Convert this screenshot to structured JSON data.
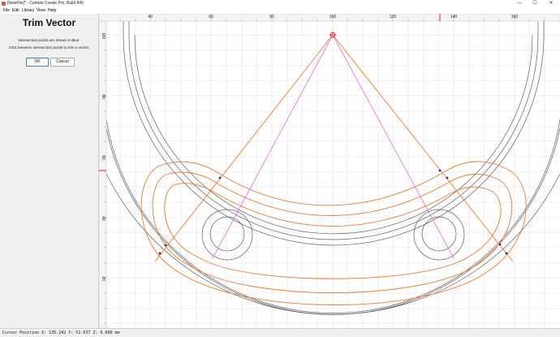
{
  "window": {
    "title": "[NewFile]* - Carbide Create Pro, Build 845",
    "minimize_glyph": "—",
    "maximize_glyph": "☐",
    "close_glyph": "✕",
    "app_icon": "carbide-create-icon"
  },
  "menu": [
    "File",
    "Edit",
    "Library",
    "View",
    "Help"
  ],
  "panel": {
    "title": "Trim Vector",
    "line1": "Intersection points are shown in Blue.",
    "line2": "Click between intersection points to trim a vector.",
    "ok_label": "OK",
    "cancel_label": "Cancel"
  },
  "ruler": {
    "top_ticks": [
      "40",
      "60",
      "80",
      "100",
      "120",
      "140",
      "160"
    ],
    "left_ticks": [
      "100",
      "80",
      "60",
      "40",
      "20"
    ]
  },
  "status": {
    "cursor": "Cursor Position X: 135.242 Y: 51.637 Z: 0.000 mm"
  },
  "colors": {
    "offset_vector": "#f07a2c",
    "construction_line": "#e36ae9",
    "vector": "#5e5e5e",
    "intersection": "#2a2a80",
    "grid": "#e2e2e2",
    "cursor_marker": "#e02020"
  }
}
